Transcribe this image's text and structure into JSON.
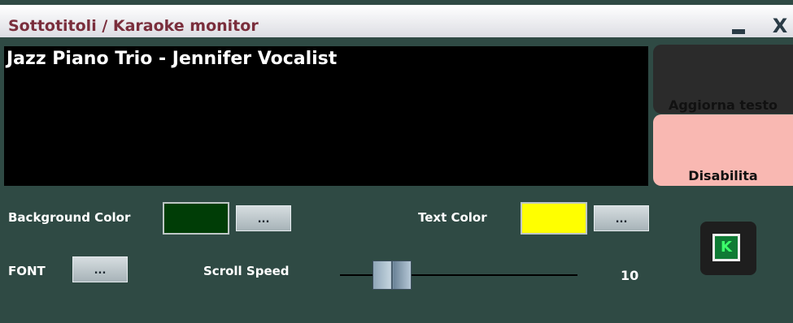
{
  "window": {
    "title": "Sottotitoli / Karaoke monitor",
    "minimize_symbol": "",
    "close_symbol": "X"
  },
  "monitor": {
    "text": "Jazz Piano Trio - Jennifer Vocalist",
    "background": "#000000",
    "text_color": "#ffffff"
  },
  "buttons": {
    "update_text": "Aggiorna testo",
    "disable": "Disabilita"
  },
  "controls": {
    "background_color_label": "Background Color",
    "background_color_value": "#003d06",
    "text_color_label": "Text Color",
    "text_color_value": "#ffff00",
    "font_label": "FONT",
    "ellipsis": "...",
    "scroll_speed_label": "Scroll Speed",
    "scroll_speed_value": "10"
  },
  "karaoke_icon": {
    "name": "karaoke-k-icon",
    "letter": "K",
    "color": "#3cff6a"
  }
}
